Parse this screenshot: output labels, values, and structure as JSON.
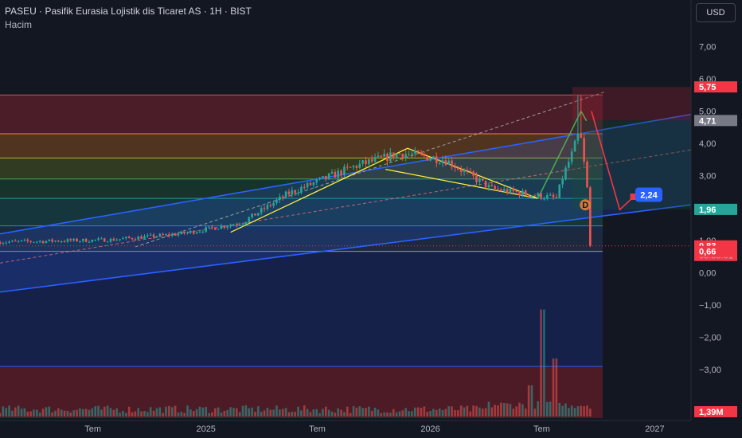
{
  "header": {
    "title": "PASEU · Pasifik Eurasia Lojistik dis Ticaret AS · 1H · BIST",
    "subtitle": "Hacim"
  },
  "toolbar": {
    "currency_label": "USD"
  },
  "colors": {
    "background": "#131722",
    "up": "#26a69a",
    "down": "#ef5350",
    "channel": "#2962ff",
    "pattern": "#ffeb3b",
    "forecast_up": "#4caf50",
    "forecast_down": "#f23645",
    "label_blue": "#2962ff"
  },
  "chart_data": {
    "type": "candlestick",
    "title": "PASEU · Pasifik Eurasia Lojistik dis Ticaret AS · 1H · BIST",
    "x_axis": {
      "labels": [
        "Tem",
        "2025",
        "Tem",
        "2026",
        "Tem",
        "2027"
      ],
      "start_date": "2024-02",
      "end_date": "2027-03"
    },
    "y_axis": {
      "ticks": [
        7,
        6,
        5,
        4,
        3,
        2,
        1,
        0,
        -1,
        -2,
        -3
      ],
      "tick_labels": [
        "7,00",
        "6,00",
        "5,00",
        "4,00",
        "3,00",
        "2,00",
        "1,00",
        "0,00",
        "−1,00",
        "−2,00",
        "−3,00"
      ],
      "range": [
        -4.5,
        7.7
      ]
    },
    "price_labels": [
      {
        "value": 5.75,
        "text": "5,75",
        "color": "#f23645"
      },
      {
        "value": 4.71,
        "text": "4,71",
        "color": "#787b86"
      },
      {
        "value": 1.96,
        "text": "1,96",
        "color": "#26a69a"
      },
      {
        "value": 0.83,
        "text": "0,83",
        "color": "#f23645",
        "countdown": "05:39:01"
      },
      {
        "value": 0.66,
        "text": "0,66",
        "color": "#f23645"
      }
    ],
    "volume_label": {
      "text": "1,39M",
      "color": "#f23645"
    },
    "fib_levels": [
      5.5,
      4.3,
      3.55,
      2.9,
      2.3,
      1.45,
      0.66,
      -2.9
    ],
    "annotations": [
      {
        "type": "label",
        "text": "2,24",
        "date": "2026-11-20",
        "value": 2.24,
        "color": "#2962ff"
      },
      {
        "type": "dividend_marker",
        "text": "D",
        "date": "2026-09-10",
        "value": 2.1
      }
    ],
    "series": [
      {
        "name": "PASEU",
        "kind": "ohlc",
        "points": []
      },
      {
        "name": "Hacim",
        "kind": "volume",
        "values": []
      }
    ]
  }
}
